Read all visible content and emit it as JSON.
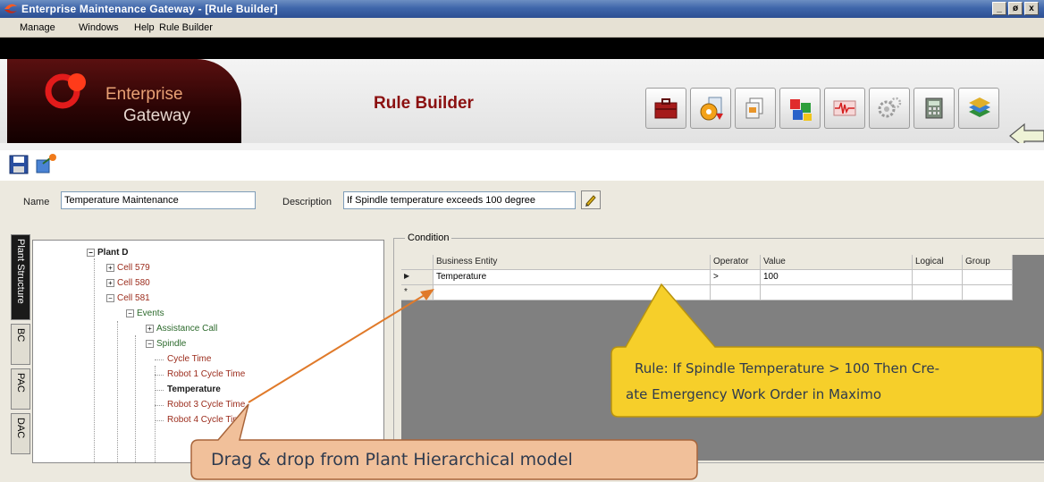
{
  "window": {
    "title": "Enterprise Maintenance Gateway - [Rule Builder]",
    "controls": [
      "_",
      "ø",
      "x"
    ]
  },
  "menu": [
    "Manage",
    "Windows",
    "Help",
    "Rule Builder"
  ],
  "banner": {
    "logo_line1": "Enterprise",
    "logo_line2": "Gateway",
    "module_title": "Rule Builder",
    "toolbar_icons": [
      "briefcase-icon",
      "disc-arrow-icon",
      "documents-icon",
      "cubes-icon",
      "waveform-icon",
      "gears-icon",
      "calculator-icon",
      "books-icon"
    ]
  },
  "actions": [
    "save-icon",
    "export-icon"
  ],
  "form": {
    "name_label": "Name",
    "name_value": "Temperature Maintenance",
    "description_label": "Description",
    "description_value": "If Spindle temperature exceeds 100 degree"
  },
  "side_tabs": [
    "Plant Structure",
    "BC",
    "PAC",
    "DAC"
  ],
  "tree": [
    {
      "label": "Plant D",
      "expander": "−",
      "style": "dark"
    },
    {
      "label": "Cell 579",
      "expander": "+",
      "style": "red"
    },
    {
      "label": "Cell 580",
      "expander": "+",
      "style": "red"
    },
    {
      "label": "Cell 581",
      "expander": "−",
      "style": "red"
    },
    {
      "label": "Events",
      "expander": "−",
      "style": "green"
    },
    {
      "label": "Assistance Call",
      "expander": "+",
      "style": "green"
    },
    {
      "label": "Spindle",
      "expander": "−",
      "style": "green"
    },
    {
      "label": "Cycle Time",
      "expander": "",
      "style": "red"
    },
    {
      "label": "Robot 1 Cycle Time",
      "expander": "",
      "style": "red"
    },
    {
      "label": "Temperature",
      "expander": "",
      "style": "dark"
    },
    {
      "label": "Robot 3 Cycle Time",
      "expander": "",
      "style": "red"
    },
    {
      "label": "Robot 4 Cycle Time",
      "expander": "",
      "style": "red"
    }
  ],
  "condition": {
    "legend": "Condition",
    "columns": [
      "Business Entity",
      "Operator",
      "Value",
      "Logical",
      "Group"
    ],
    "rows": [
      {
        "marker": "▶",
        "cells": [
          "Temperature",
          ">",
          "100",
          "",
          ""
        ]
      },
      {
        "marker": "*",
        "cells": [
          "",
          "",
          "",
          "",
          ""
        ]
      }
    ]
  },
  "callouts": {
    "rule_line1": "Rule: If Spindle Temperature > 100 Then Cre-",
    "rule_line2": "ate  Emergency Work Order in Maximo",
    "drag": "Drag & drop from Plant Hierarchical model"
  }
}
